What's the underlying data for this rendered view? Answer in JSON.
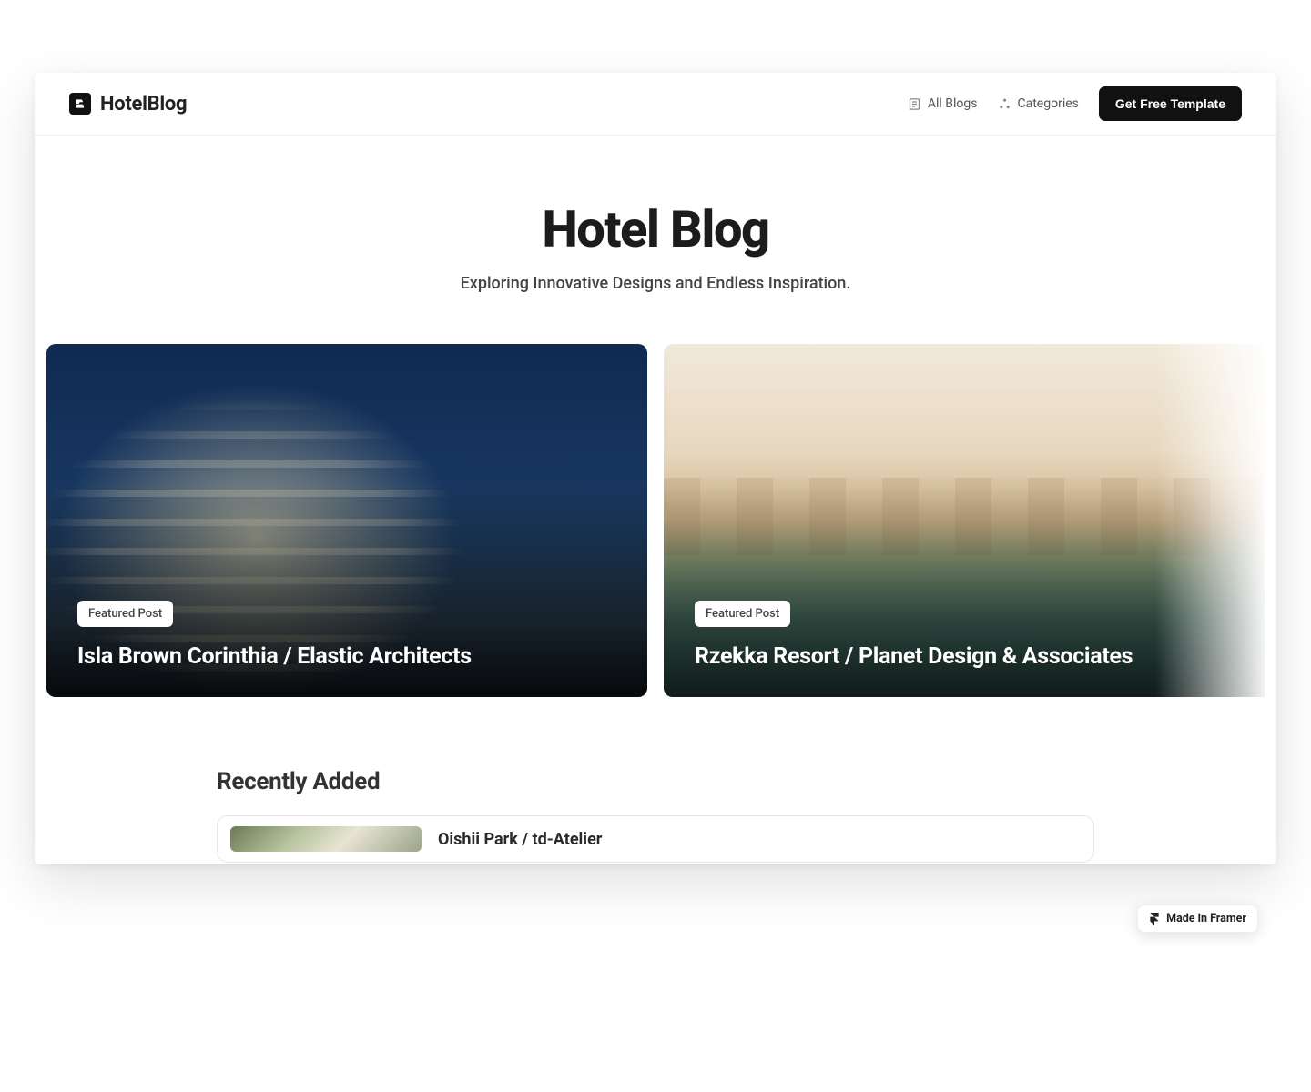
{
  "header": {
    "brand": "HotelBlog",
    "nav": {
      "all_blogs": "All Blogs",
      "categories": "Categories"
    },
    "cta": "Get Free Template"
  },
  "hero": {
    "title": "Hotel Blog",
    "subtitle": "Exploring Innovative Designs and Endless Inspiration."
  },
  "featured": [
    {
      "badge": "Featured Post",
      "title": "Isla Brown Corinthia / Elastic Architects"
    },
    {
      "badge": "Featured Post",
      "title": "Rzekka Resort / Planet Design & Associates"
    }
  ],
  "recently": {
    "heading": "Recently Added",
    "items": [
      {
        "title": "Oishii Park / td-Atelier"
      }
    ]
  },
  "framer_badge": "Made in Framer"
}
